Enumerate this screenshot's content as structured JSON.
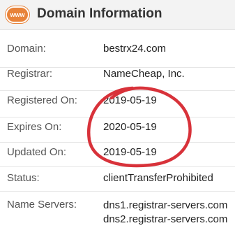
{
  "header": {
    "icon_text": "www",
    "icon": "www-globe-icon",
    "title": "Domain Information",
    "accent": "#e8833a"
  },
  "rows": {
    "domain": {
      "label": "Domain:",
      "value": "bestrx24.com"
    },
    "registrar": {
      "label": "Registrar:",
      "value": "NameCheap, Inc."
    },
    "registered": {
      "label": "Registered On:",
      "value": "2019-05-19"
    },
    "expires": {
      "label": "Expires On:",
      "value": "2020-05-19"
    },
    "updated": {
      "label": "Updated On:",
      "value": "2019-05-19"
    },
    "status": {
      "label": "Status:",
      "value": "clientTransferProhibited"
    },
    "nameservers": {
      "label": "Name Servers:",
      "values": [
        "dns1.registrar-servers.com",
        "dns2.registrar-servers.com"
      ]
    }
  },
  "annotation": {
    "color": "#d8323a"
  }
}
